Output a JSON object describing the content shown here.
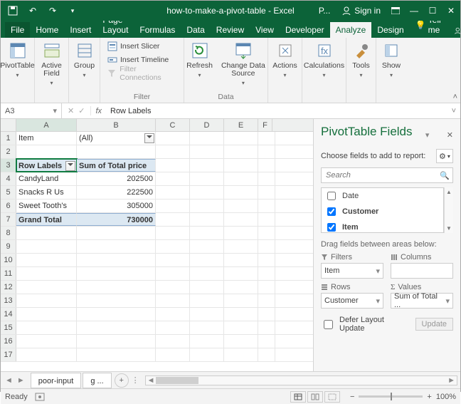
{
  "titlebar": {
    "title": "how-to-make-a-pivot-table - Excel",
    "extra": "P...",
    "signin": "Sign in"
  },
  "menu": {
    "file": "File",
    "home": "Home",
    "insert": "Insert",
    "pagelayout": "Page Layout",
    "formulas": "Formulas",
    "data": "Data",
    "review": "Review",
    "view": "View",
    "developer": "Developer",
    "analyze": "Analyze",
    "design": "Design",
    "tellme": "Tell me",
    "share": "Share"
  },
  "ribbon": {
    "pivottable": "PivotTable",
    "activefield": "Active\nField",
    "group": "Group",
    "insert_slicer": "Insert Slicer",
    "insert_timeline": "Insert Timeline",
    "filter_conn": "Filter Connections",
    "filter_label": "Filter",
    "refresh": "Refresh",
    "change_ds": "Change Data\nSource",
    "data_label": "Data",
    "actions": "Actions",
    "calculations": "Calculations",
    "tools": "Tools",
    "show": "Show"
  },
  "namebox": "A3",
  "formula": "Row Labels",
  "columns": [
    "A",
    "B",
    "C",
    "D",
    "E",
    "F"
  ],
  "rows": [
    {
      "n": 1,
      "A": "Item",
      "B": "(All)",
      "filterB": true
    },
    {
      "n": 2
    },
    {
      "n": 3,
      "A": "Row Labels",
      "B": "Sum of Total price",
      "head": true,
      "filterA": true,
      "sel": true
    },
    {
      "n": 4,
      "A": "CandyLand",
      "B": "202500"
    },
    {
      "n": 5,
      "A": "Snacks R Us",
      "B": "222500"
    },
    {
      "n": 6,
      "A": "Sweet Tooth's",
      "B": "305000"
    },
    {
      "n": 7,
      "A": "Grand Total",
      "B": "730000",
      "total": true
    },
    {
      "n": 8
    },
    {
      "n": 9
    },
    {
      "n": 10
    },
    {
      "n": 11
    },
    {
      "n": 12
    },
    {
      "n": 13
    },
    {
      "n": 14
    },
    {
      "n": 15
    },
    {
      "n": 16
    },
    {
      "n": 17
    }
  ],
  "ptpane": {
    "title": "PivotTable Fields",
    "choose": "Choose fields to add to report:",
    "search_ph": "Search",
    "fields": [
      {
        "label": "Date",
        "checked": false
      },
      {
        "label": "Customer",
        "checked": true
      },
      {
        "label": "Item",
        "checked": true
      }
    ],
    "drag": "Drag fields between areas below:",
    "filters_lbl": "Filters",
    "columns_lbl": "Columns",
    "rows_lbl": "Rows",
    "values_lbl": "Values",
    "filters_val": "Item",
    "rows_val": "Customer",
    "values_val": "Sum of Total ...",
    "defer": "Defer Layout Update",
    "update": "Update"
  },
  "sheets": {
    "s1": "poor-input",
    "s2": "g ..."
  },
  "status": {
    "ready": "Ready",
    "zoom": "100%"
  }
}
